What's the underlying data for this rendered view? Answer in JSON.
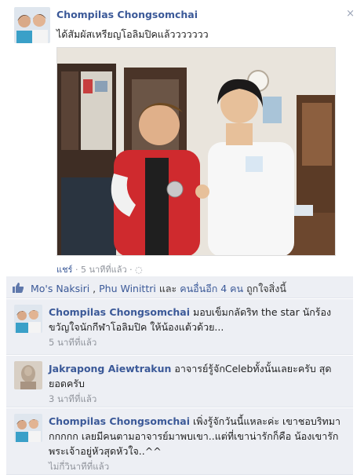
{
  "post": {
    "author": "Chompilas Chongsomchai",
    "status_text": "ได้สัมผัสเหรียญโอลิมปิคแล้ววววววว",
    "close_label": "×",
    "share_label": "แชร์",
    "timestamp": "· 5 นาทีที่แล้ว ·"
  },
  "likes": {
    "name1": "Mo's Naksiri",
    "separator": " , ",
    "name2": "Phu Winittri",
    "and": " และ ",
    "others": "คนอื่นอีก 4 คน",
    "suffix": " ถูกใจสิ่งนี้"
  },
  "comments": [
    {
      "author": "Chompilas Chongsomchai",
      "text": " มอบเข็มกลัดริท the star นักร้องขวัญใจนักกีฬาโอลิมปิค ให้น้องแต้วด้วย...",
      "time": "5 นาทีที่แล้ว"
    },
    {
      "author": "Jakrapong Aiewtrakun",
      "text": " อาจารย์รู้จักCelebทั้งนั้นเลยะครับ สุดยอดครับ",
      "time": "3 นาทีที่แล้ว"
    },
    {
      "author": "Chompilas Chongsomchai",
      "text": " เพิ่งรู้จักวันนี้แหละค่ะ เขาชอบริทมากกกกก เลยมีคนตามอาจารย์มาพบเขา..แต่ที่เขาน่ารักก็คือ น้องเขารักพระเจ้าอยู่หัวสุดหัวใจ..^^",
      "time": "ไม่กี่วินาทีที่แล้ว"
    }
  ]
}
